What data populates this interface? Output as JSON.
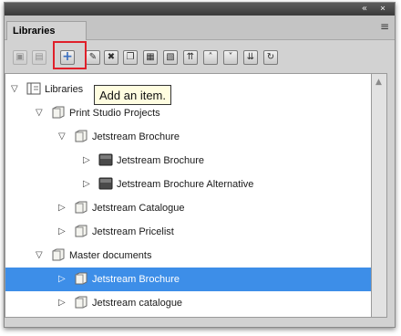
{
  "window": {
    "collapse_glyph": "«",
    "close_glyph": "×"
  },
  "tab": {
    "label": "Libraries"
  },
  "panel_menu_glyph": "≡",
  "toolbar": {
    "buttons": [
      {
        "icon": "new-library-icon",
        "glyph": "▣",
        "state": "disabled"
      },
      {
        "icon": "save-library-icon",
        "glyph": "▤",
        "state": "disabled"
      },
      {
        "icon": "add-item-icon",
        "glyph": "+",
        "state": "highlighted"
      },
      {
        "icon": "edit-item-icon",
        "glyph": "✎",
        "state": "enabled"
      },
      {
        "icon": "delete-item-icon",
        "glyph": "✖",
        "state": "enabled"
      },
      {
        "icon": "duplicate-item-icon",
        "glyph": "❐",
        "state": "enabled"
      },
      {
        "icon": "properties-icon",
        "glyph": "▦",
        "state": "enabled"
      },
      {
        "icon": "paste-icon",
        "glyph": "▧",
        "state": "enabled"
      },
      {
        "icon": "move-top-icon",
        "glyph": "⇈",
        "state": "enabled"
      },
      {
        "icon": "move-up-icon",
        "glyph": "˄",
        "state": "enabled"
      },
      {
        "icon": "move-down-icon",
        "glyph": "˅",
        "state": "enabled"
      },
      {
        "icon": "move-bottom-icon",
        "glyph": "⇊",
        "state": "enabled"
      },
      {
        "icon": "refresh-icon",
        "glyph": "↻",
        "state": "enabled"
      }
    ]
  },
  "tooltip": {
    "text": "Add an item."
  },
  "tree": {
    "items": [
      {
        "label": "Libraries",
        "level": 0,
        "expanded": true,
        "type": "root"
      },
      {
        "label": "Print Studio Projects",
        "level": 1,
        "expanded": true,
        "type": "folder"
      },
      {
        "label": "Jetstream Brochure",
        "level": 2,
        "expanded": true,
        "type": "folder"
      },
      {
        "label": "Jetstream Brochure",
        "level": 3,
        "expanded": false,
        "type": "document"
      },
      {
        "label": "Jetstream Brochure Alternative",
        "level": 3,
        "expanded": false,
        "type": "document"
      },
      {
        "label": "Jetstream Catalogue",
        "level": 2,
        "expanded": false,
        "type": "folder"
      },
      {
        "label": "Jetstream Pricelist",
        "level": 2,
        "expanded": false,
        "type": "folder"
      },
      {
        "label": "Master documents",
        "level": 1,
        "expanded": true,
        "type": "folder"
      },
      {
        "label": "Jetstream Brochure",
        "level": 2,
        "expanded": false,
        "type": "folder",
        "selected": true
      },
      {
        "label": "Jetstream catalogue",
        "level": 2,
        "expanded": false,
        "type": "folder"
      }
    ]
  },
  "colors": {
    "selection": "#3d8ee8",
    "highlight_box": "#e0202a",
    "tooltip_bg": "#fffde0"
  }
}
